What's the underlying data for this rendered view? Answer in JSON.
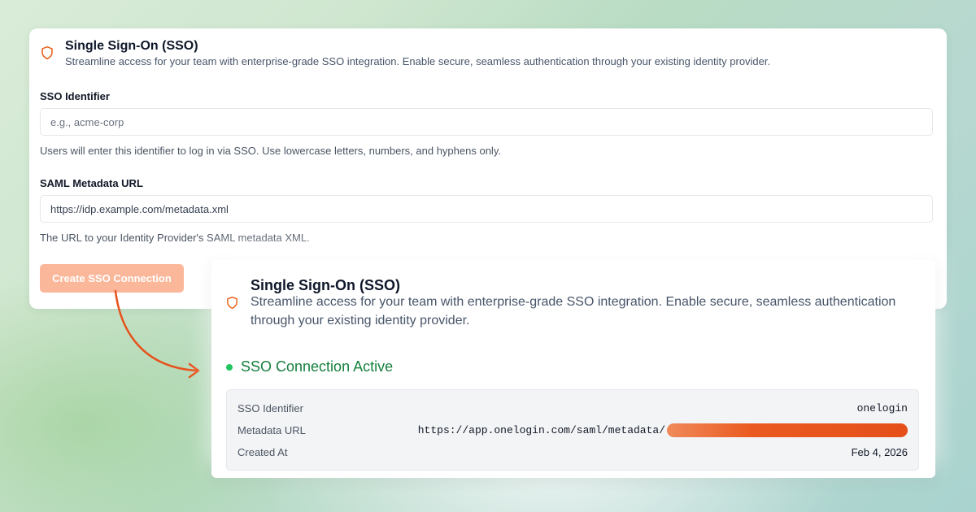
{
  "form_card": {
    "title": "Single Sign-On (SSO)",
    "description": "Streamline access for your team with enterprise-grade SSO integration. Enable secure, seamless authentication through your existing identity provider.",
    "sso_identifier": {
      "label": "SSO Identifier",
      "placeholder": "e.g., acme-corp",
      "help": "Users will enter this identifier to log in via SSO. Use lowercase letters, numbers, and hyphens only."
    },
    "metadata_url": {
      "label": "SAML Metadata URL",
      "value": "https://idp.example.com/metadata.xml",
      "help": "The URL to your Identity Provider's SAML metadata XML."
    },
    "create_button_label": "Create SSO Connection"
  },
  "result_card": {
    "title": "Single Sign-On (SSO)",
    "description": "Streamline access for your team with enterprise-grade SSO integration. Enable secure, seamless authentication through your existing identity provider.",
    "status": "SSO Connection Active",
    "details": {
      "sso_identifier_label": "SSO Identifier",
      "sso_identifier_value": "onelogin",
      "metadata_url_label": "Metadata URL",
      "metadata_url_value": "https://app.onelogin.com/saml/metadata/",
      "created_at_label": "Created At",
      "created_at_value": "Feb 4, 2026"
    }
  },
  "icons": {
    "shield": "shield-icon",
    "arrow": "curved-arrow-icon"
  },
  "colors": {
    "accent": "#ea580c",
    "button_disabled": "#fbb79a",
    "status_green": "#22c55e",
    "status_text": "#15803d",
    "redaction": "#e5501a"
  }
}
